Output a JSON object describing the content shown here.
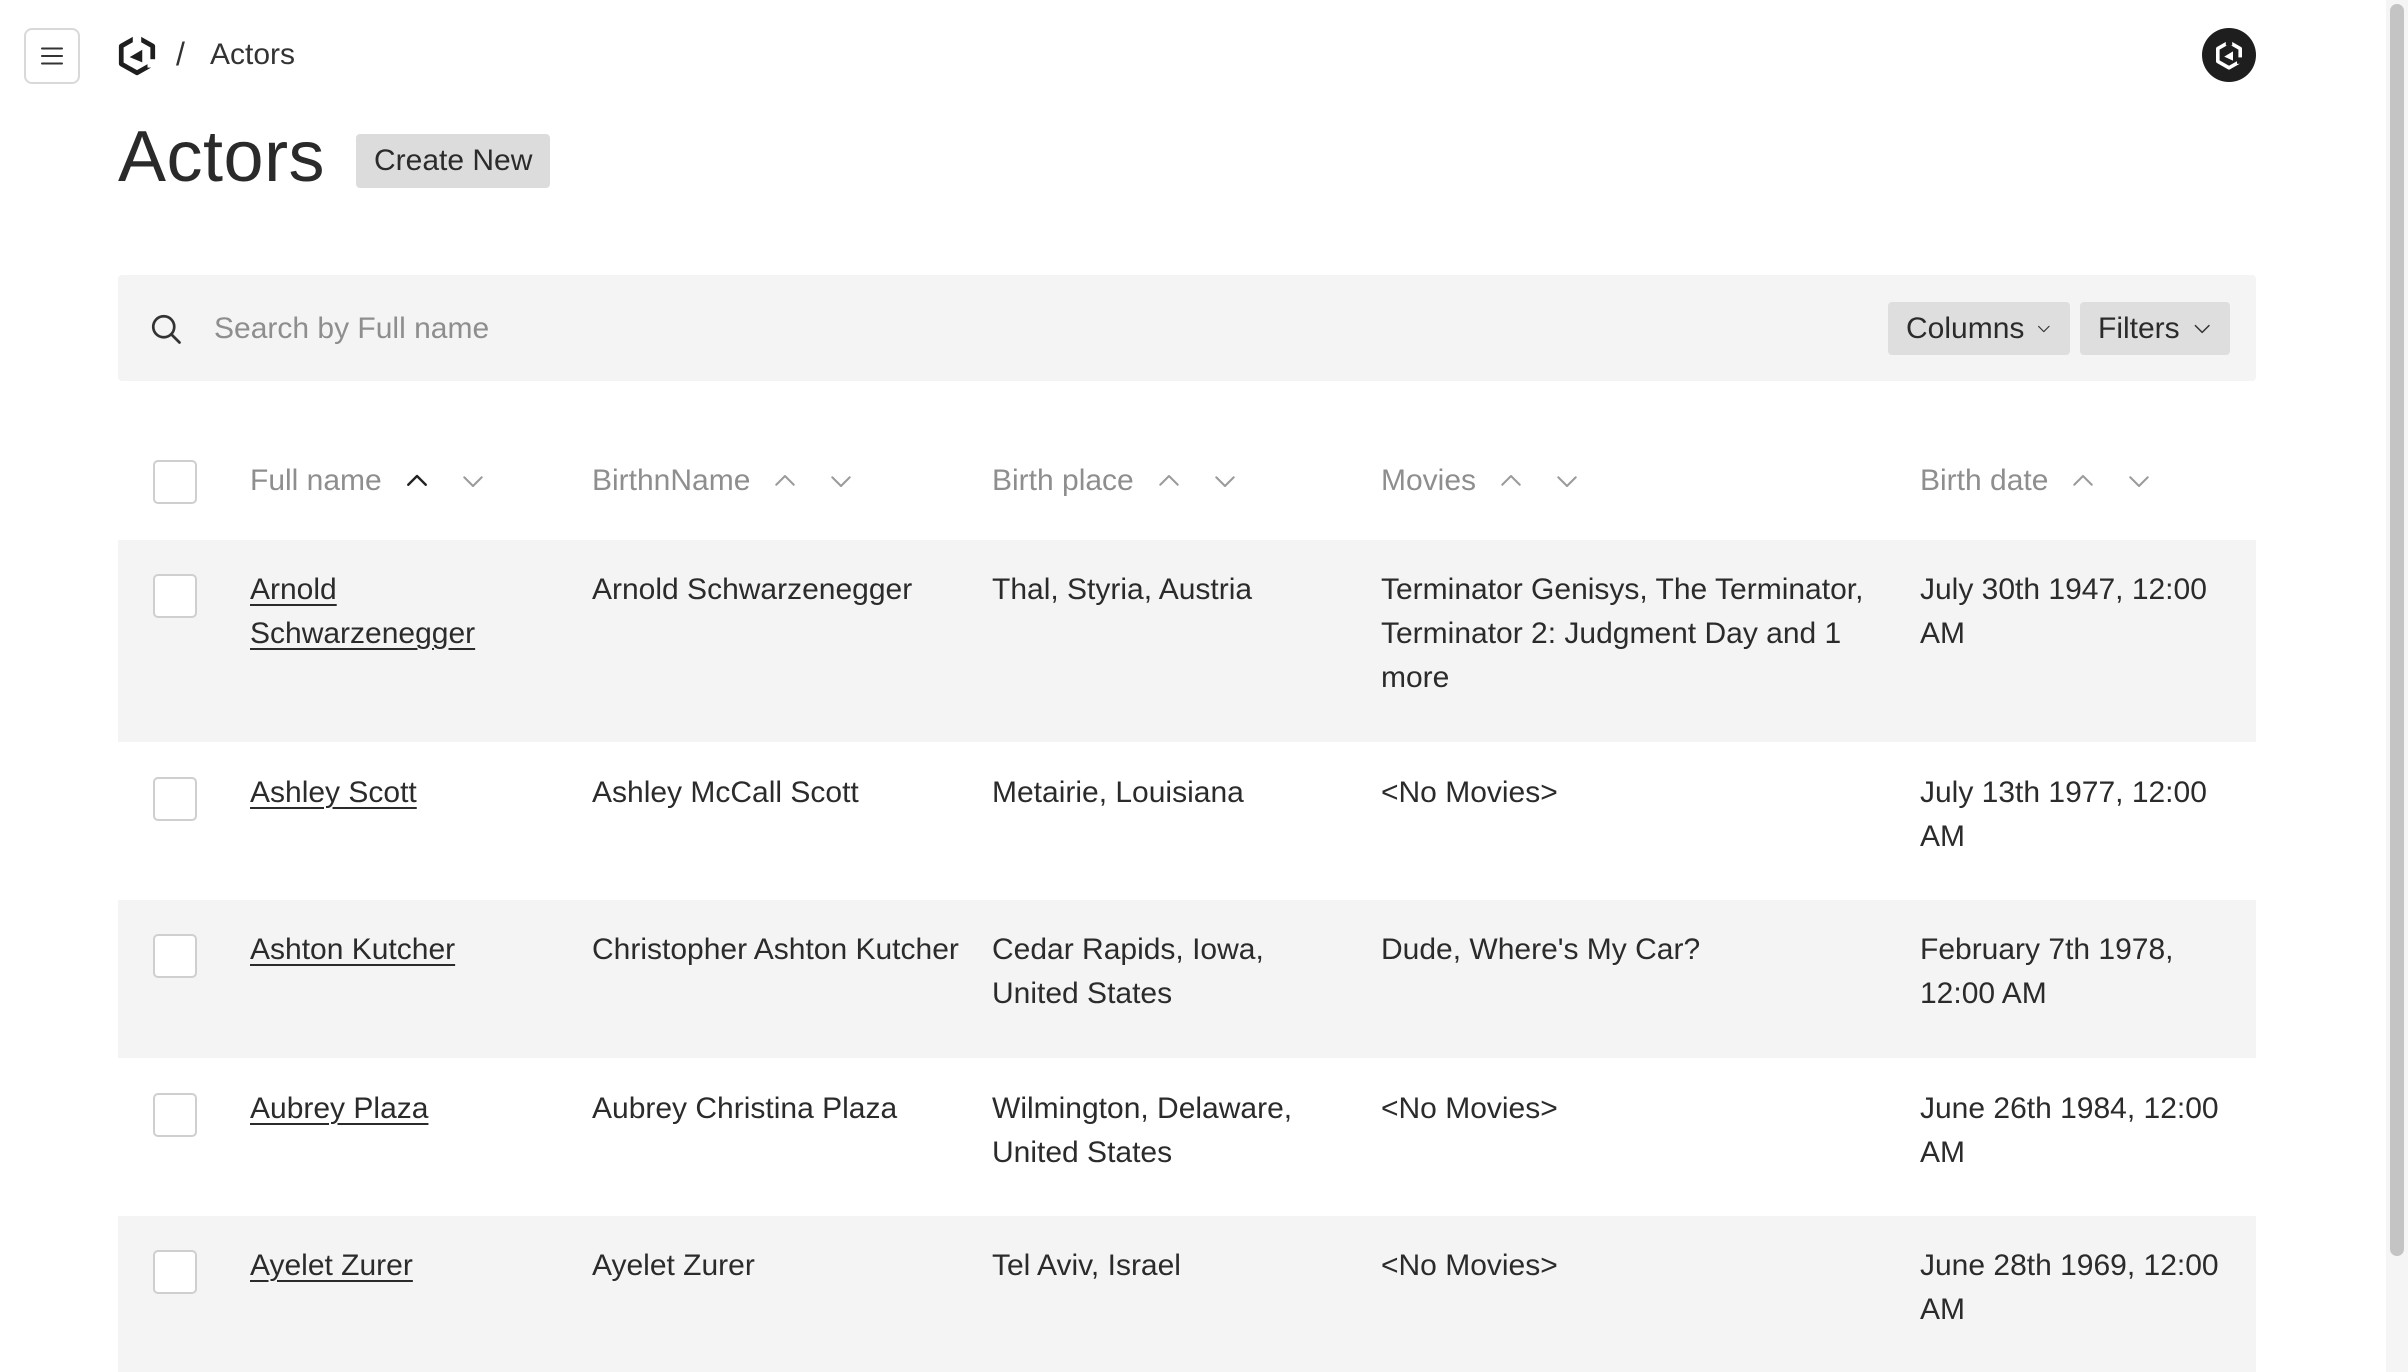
{
  "breadcrumb": {
    "separator": "/",
    "current": "Actors"
  },
  "page": {
    "title": "Actors",
    "create_label": "Create New"
  },
  "search": {
    "placeholder": "Search by Full name",
    "value": ""
  },
  "toolbar": {
    "columns_label": "Columns",
    "filters_label": "Filters"
  },
  "table": {
    "headers": [
      "Full name",
      "BirthnName",
      "Birth place",
      "Movies",
      "Birth date"
    ],
    "sorted_column": "Full name",
    "sort_direction": "ascending",
    "rows": [
      {
        "full_name": "Arnold Schwarzenegger",
        "birth_name": "Arnold Schwarzenegger",
        "birth_place": "Thal, Styria, Austria",
        "movies": "Terminator Genisys, The Terminator, Terminator 2: Judgment Day and 1 more",
        "birth_date": "July 30th 1947, 12:00 AM"
      },
      {
        "full_name": "Ashley Scott",
        "birth_name": "Ashley McCall Scott",
        "birth_place": "Metairie, Louisiana",
        "movies": "<No Movies>",
        "birth_date": "July 13th 1977, 12:00 AM"
      },
      {
        "full_name": "Ashton Kutcher",
        "birth_name": "Christopher Ashton Kutcher",
        "birth_place": "Cedar Rapids, Iowa, United States",
        "movies": "Dude, Where's My Car?",
        "birth_date": "February 7th 1978, 12:00 AM"
      },
      {
        "full_name": "Aubrey Plaza",
        "birth_name": "Aubrey Christina Plaza",
        "birth_place": "Wilmington, Delaware, United States",
        "movies": "<No Movies>",
        "birth_date": "June 26th 1984, 12:00 AM"
      },
      {
        "full_name": "Ayelet Zurer",
        "birth_name": "Ayelet Zurer",
        "birth_place": "Tel Aviv, Israel",
        "movies": "<No Movies>",
        "birth_date": "June 28th 1969, 12:00 AM"
      }
    ]
  },
  "icons": {
    "menu": "hamburger-menu-icon",
    "logo": "app-logo-icon",
    "avatar": "user-avatar-icon",
    "search": "search-icon",
    "dropdown": "chevron-down-icon",
    "sort_up": "chevron-up-icon",
    "sort_down": "chevron-down-icon"
  },
  "colors": {
    "shaded_row": "#f4f4f4",
    "button_bg": "#dcdcdc",
    "muted_text": "#8e8e8e"
  }
}
